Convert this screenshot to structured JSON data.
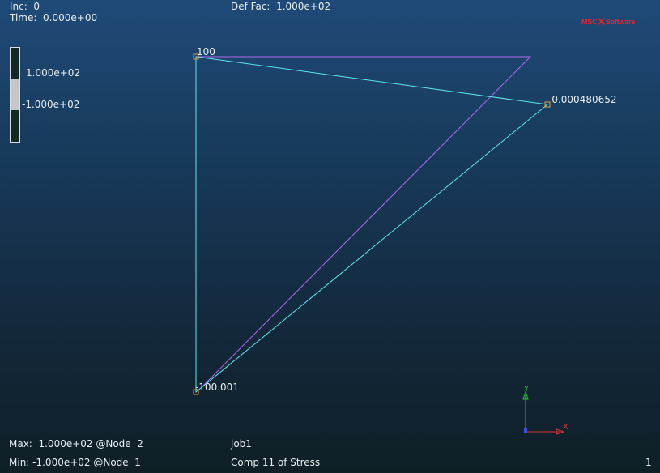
{
  "header": {
    "inc": "Inc:  0",
    "time": "Time:  0.000e+00",
    "def_fac": "Def Fac:  1.000e+02"
  },
  "legend": {
    "max_value": "1.000e+02",
    "min_value": "-1.000e+02",
    "band_color": "#c6c8c8",
    "bar_color": "#122826"
  },
  "brand": {
    "left": "MSC",
    "right": "Software",
    "color": "#e3262f"
  },
  "model": {
    "element_color_undeformed": "#b36af0",
    "element_color_deformed": "#5ee6ec",
    "node_marker_color": "#e8a23a",
    "node_labels": {
      "top_left": "100",
      "right": "-0.000480652",
      "bottom_left": "-100.001"
    }
  },
  "triad": {
    "y_label": "Y",
    "x_label": "X",
    "y_color": "#2cc63b",
    "x_color": "#e0333a",
    "z_color": "#3a4cf0"
  },
  "footer": {
    "max": "Max:  1.000e+02 @Node  2",
    "min": "Min: -1.000e+02 @Node  1",
    "job": "job1",
    "component": "Comp 11 of Stress",
    "frame": "1"
  }
}
